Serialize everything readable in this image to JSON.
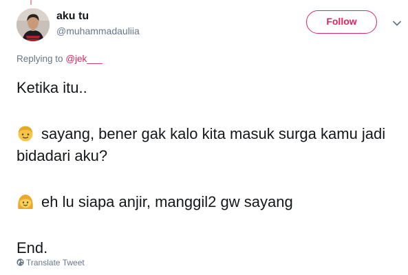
{
  "author": {
    "name": "aku tu",
    "handle": "@muhammadauliia",
    "avatar": "avatar-photo"
  },
  "actions": {
    "follow_label": "Follow",
    "menu_icon": "chevron-down-icon"
  },
  "reply": {
    "prefix": "Replying to",
    "target": "@jek___"
  },
  "tweet": {
    "line1": "Ketika itu..",
    "line2_emoji": "boy-emoji",
    "line2": "sayang, bener gak kalo kita masuk surga kamu jadi bidadari aku?",
    "line3_emoji": "girl-emoji",
    "line3": "eh lu siapa anjir, manggil2 gw sayang",
    "line4": "End."
  },
  "footer": {
    "translate_icon": "globe-icon",
    "translate_label": "Translate Tweet"
  },
  "colors": {
    "accent": "#e0245e",
    "text": "#14171a",
    "muted": "#657786",
    "background": "#ffffff"
  }
}
